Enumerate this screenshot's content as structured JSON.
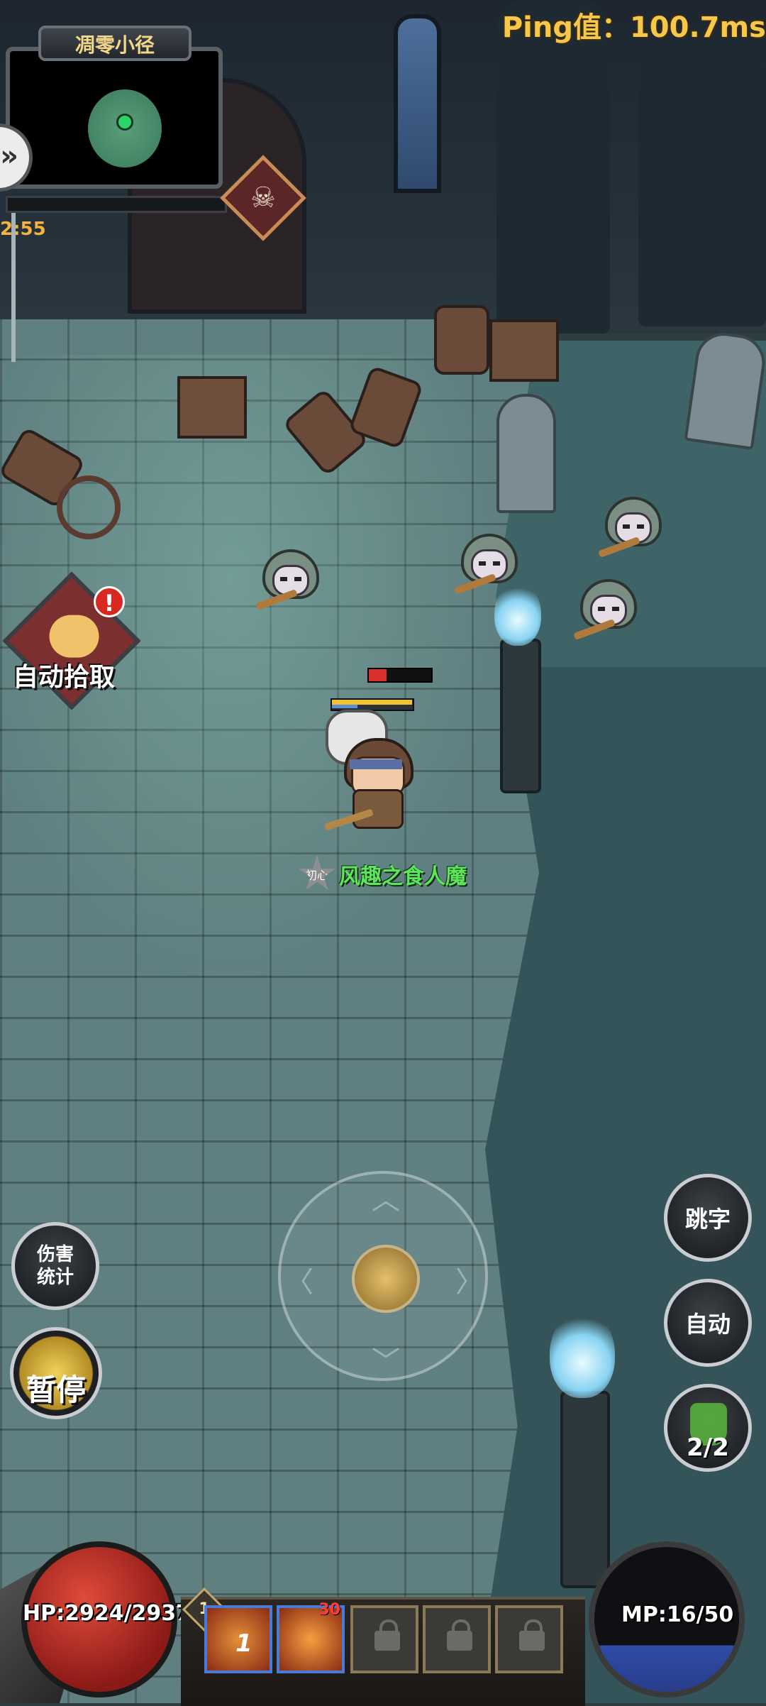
{
  "hud": {
    "ping": "Ping值：100.7ms",
    "map_name": "凋零小径",
    "timer": "2:55",
    "side_toggle": "»",
    "boss_symbol": "☠"
  },
  "actions": {
    "auto_pickup_label": "自动拾取",
    "auto_pickup_alert": "!",
    "damage_stats": "伤害统计",
    "pause": "暂停",
    "jump_text": "跳字",
    "auto": "自动",
    "potion_count": "2/2"
  },
  "player": {
    "rank": "初心",
    "name": "风趣之食人魔",
    "hp_label": "HP:2924/2937",
    "mp_label": "MP:16/50",
    "hp": 2924,
    "hp_max": 2937,
    "mp": 16,
    "mp_max": 50
  },
  "skills": {
    "level": "1",
    "slot1_label": "1",
    "slot2_badge": "30",
    "locked_slots": 3
  },
  "joystick": {
    "up": "︿",
    "down": "﹀",
    "left": "〈",
    "right": "〉"
  },
  "colors": {
    "ping": "#f5c84c",
    "player_name": "#5ce65c",
    "hp_orb": "#c0302a",
    "mp_orb": "#2d4ca8"
  },
  "icons": [
    "minimap-icon",
    "boss-skull-icon",
    "hand-icon",
    "potion-icon",
    "lock-icon",
    "skill-fire-icon"
  ]
}
